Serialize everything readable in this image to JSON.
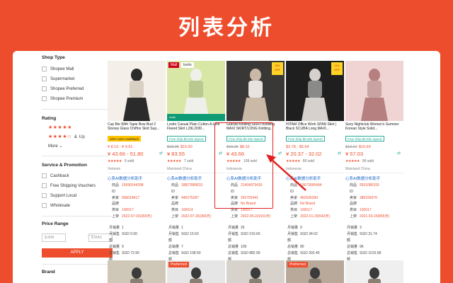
{
  "header": {
    "title": "列表分析"
  },
  "sidebar": {
    "shop_type_title": "Shop Type",
    "shop_types": [
      "Shopee Mall",
      "Supermarket",
      "Shopee Preferred",
      "Shopee Premium"
    ],
    "rating_title": "Rating",
    "rating_5": "★★★★★",
    "rating_4": "★★★★☆",
    "rating_4_suffix": "& Up",
    "more_label": "More",
    "service_title": "Service & Promotion",
    "services": [
      "Cashback",
      "Free Shipping Vouchers",
      "Support Local",
      "Wholesale"
    ],
    "price_title": "Price Range",
    "price_min_placeholder": "$ MIN",
    "price_max_placeholder": "$ MAX",
    "price_sep": "——",
    "apply_label": "APPLY",
    "brand_title": "Brand"
  },
  "products": [
    {
      "title": "Cup Bie With Tapie Bow Bud 2 Sloowy Glass Chiffon Skirt Sup...",
      "top_badge": "",
      "top_badge2": "",
      "sale_badge": "",
      "green_banner": "",
      "promo": "10% coins cashback",
      "promo_style": "yellow",
      "price_orig": "",
      "price_range": "¥ 8.10 - ¥ 9.61",
      "main_price": "¥ 43.66 - 51.80",
      "stars": "★★★★★",
      "sold": "9 sold",
      "location": "Vietnam",
      "analysis": {
        "title": "心系AI数据分析助手",
        "id": "15599144298",
        "seller": "906018417",
        "brand": "",
        "category": "100017",
        "listed": "2022-07-03(369天)"
      },
      "stats": {
        "monthly_sales": "1",
        "monthly_revenue": "SGD 0.00",
        "total_sales": "9",
        "total_revenue": "SGD 72.90"
      }
    },
    {
      "title": "Lovito Casual Plain Cotton A-Line Flared Skirt L29L2030...",
      "top_badge": "Mall",
      "top_badge2": "lovito",
      "sale_badge": "",
      "green_banner": "lovito",
      "promo": "Free Ship $0 Min Spend",
      "promo_style": "green",
      "price_orig": "$18.25",
      "price_range": "$15.50",
      "main_price": "¥ 83.55",
      "stars": "★★★★★",
      "sold": "7 sold",
      "location": "Mainland China",
      "analysis": {
        "title": "心系AI数据分析助手",
        "id": "18827889631",
        "seller": "445275287",
        "brand": "",
        "category": "100014",
        "listed": "2022-07-26(366天)"
      },
      "stats": {
        "monthly_sales": "1",
        "monthly_revenue": "SGD 15.50",
        "total_sales": "7",
        "total_revenue": "SGD 108.50"
      }
    },
    {
      "title": "Gracila Knitting SKIRT/Knitting MAXI SKIRT/LONG Knitting...",
      "top_badge": "",
      "top_badge2": "",
      "sale_badge": "15% OFF",
      "green_banner": "",
      "promo": "Free Ship $0 Min Spend",
      "promo_style": "green",
      "price_orig": "$10.26",
      "price_range": "$8.10",
      "main_price": "¥ 43.66",
      "stars": "★★★★★",
      "sold": "109 sold",
      "location": "Indonesia",
      "analysis": {
        "title": "心系AI数据分析助手",
        "id": "21404073416",
        "seller": "292792441",
        "brand": "No Brand",
        "category": "100017",
        "listed": "2022-05-22(431天)"
      },
      "stats": {
        "monthly_sales": "26",
        "monthly_revenue": "SGD 210.60",
        "total_sales": "109",
        "total_revenue": "SGD 882.90"
      }
    },
    {
      "title": "HITAM Office Work SPAN Skirt | Black SCUBA Long MAXI...",
      "top_badge": "",
      "top_badge2": "",
      "sale_badge": "21% OFF",
      "green_banner": "",
      "promo": "Free Ship $0 Min Spend",
      "promo_style": "green",
      "price_orig": "",
      "price_range": "$3.78 - $5.94",
      "main_price": "¥ 20.37 - 32.02",
      "stars": "★★★★★",
      "sold": "80 sold",
      "location": "Indonesia",
      "analysis": {
        "title": "心系AI数据分析助手",
        "id": "13673995494",
        "seller": "462936399",
        "brand": "No Brand",
        "category": "100017",
        "listed": "2022-01-29(543天)"
      },
      "stats": {
        "monthly_sales": "9",
        "monthly_revenue": "SGD 34.02",
        "total_sales": "80",
        "total_revenue": "SGD 302.40"
      }
    },
    {
      "title": "Sexy Nightclub Women's Summer Korean Style Solid...",
      "top_badge": "",
      "top_badge2": "",
      "sale_badge": "",
      "green_banner": "",
      "promo": "Free Ship $0 Min Spend",
      "promo_style": "green",
      "price_orig": "$12.17",
      "price_range": "$10.59",
      "main_price": "¥ 57.03",
      "stars": "★★★★★",
      "sold": "96 sold",
      "location": "Mainland China",
      "analysis": {
        "title": "心系AI数据分析助手",
        "id": "9531080155",
        "seller": "385239376",
        "brand": "",
        "category": "100017",
        "listed": "2021-03-24(855天)"
      },
      "stats": {
        "monthly_sales": "3",
        "monthly_revenue": "SGD 31.74",
        "total_sales": "96",
        "total_revenue": "SGD 1015.68"
      }
    }
  ],
  "labels": {
    "id": "商品ID",
    "seller": "卖家",
    "brand": "品牌",
    "category": "类目",
    "listed": "上架",
    "monthly_sales": "月销量",
    "monthly_revenue": "月销售额",
    "total_sales": "总销量",
    "total_revenue": "总销售额"
  },
  "bottom_row": [
    {
      "badge": "",
      "sale": ""
    },
    {
      "badge": "Preferred",
      "sale": ""
    },
    {
      "badge": "",
      "sale": ""
    },
    {
      "badge": "Preferred",
      "sale": ""
    },
    {
      "badge": "",
      "sale": ""
    }
  ],
  "colors": {
    "accent": "#ee4d2d",
    "link": "#1a66c9",
    "highlight": "#e02020",
    "green": "#26aa99"
  }
}
